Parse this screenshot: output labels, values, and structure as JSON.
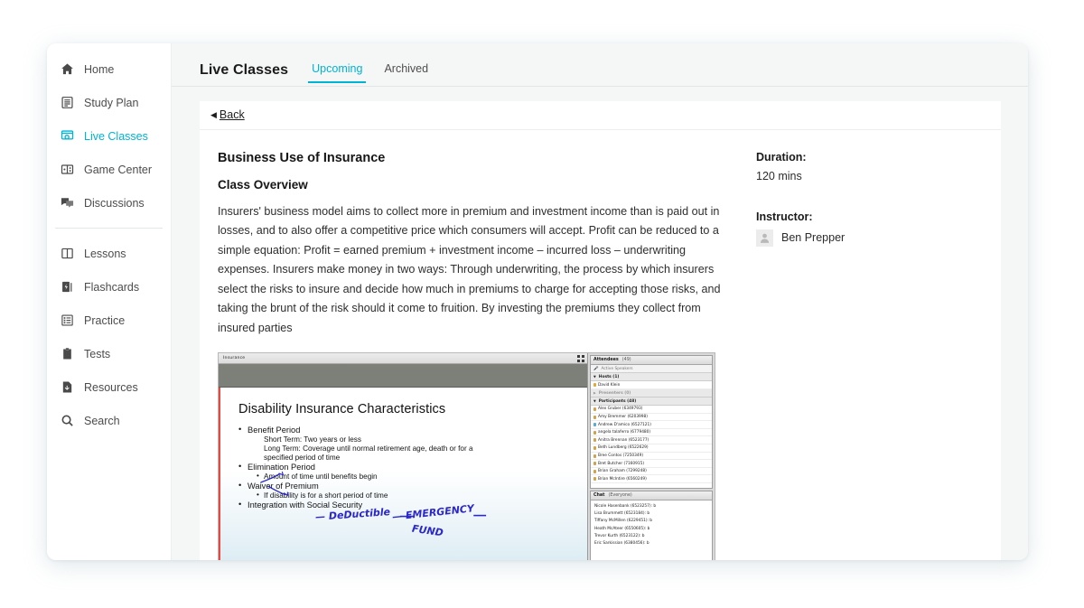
{
  "sidebar": {
    "groups": [
      {
        "items": [
          {
            "label": "Home",
            "icon": "home-icon",
            "active": false
          },
          {
            "label": "Study Plan",
            "icon": "study-plan-icon",
            "active": false
          },
          {
            "label": "Live Classes",
            "icon": "live-classes-icon",
            "active": true
          },
          {
            "label": "Game Center",
            "icon": "game-center-icon",
            "active": false
          },
          {
            "label": "Discussions",
            "icon": "discussions-icon",
            "active": false
          }
        ]
      },
      {
        "items": [
          {
            "label": "Lessons",
            "icon": "lessons-icon",
            "active": false
          },
          {
            "label": "Flashcards",
            "icon": "flashcards-icon",
            "active": false
          },
          {
            "label": "Practice",
            "icon": "practice-icon",
            "active": false
          },
          {
            "label": "Tests",
            "icon": "tests-icon",
            "active": false
          },
          {
            "label": "Resources",
            "icon": "resources-icon",
            "active": false
          },
          {
            "label": "Search",
            "icon": "search-icon",
            "active": false
          }
        ]
      }
    ]
  },
  "header": {
    "title": "Live Classes",
    "tabs": [
      {
        "label": "Upcoming",
        "active": true
      },
      {
        "label": "Archived",
        "active": false
      }
    ]
  },
  "backbar": {
    "caret": "◀",
    "label": "Back"
  },
  "detail": {
    "class_title": "Business Use of Insurance",
    "section_title": "Class Overview",
    "overview": "Insurers' business model aims to collect more in premium and investment income than is paid out in losses, and to also offer a competitive price which consumers will accept. Profit can be reduced to a simple equation: Profit = earned premium + investment income – incurred loss – underwriting expenses. Insurers make money in two ways: Through underwriting, the process by which insurers select the risks to insure and decide how much in premiums to charge for accepting those risks, and taking the brunt of the risk should it come to fruition. By investing the premiums they collect from insured parties",
    "duration_label": "Duration:",
    "duration_value": "120 mins",
    "instructor_label": "Instructor:",
    "instructor_name": "Ben Prepper",
    "instructor_avatar_icon": "person-avatar-icon"
  },
  "video": {
    "window_title": "Insurance",
    "fullscreen_icon": "fullscreen-icon",
    "slide": {
      "heading": "Disability Insurance Characteristics",
      "bullets": [
        {
          "level": 1,
          "text": "Benefit Period",
          "dot": true
        },
        {
          "level": 2,
          "text": "Short Term:  Two years or less",
          "dot": false
        },
        {
          "level": 2,
          "text": "Long Term:  Coverage until normal retirement age, death or for a",
          "dot": false,
          "underline_part": "retirement age,"
        },
        {
          "level": 2,
          "text": "specified period of time",
          "dot": false,
          "continuation": true
        },
        {
          "level": 1,
          "text": "Elimination Period",
          "dot": true
        },
        {
          "level": 2,
          "text": "Amount of time until benefits begin",
          "dot": true
        },
        {
          "level": 1,
          "text": "Waiver of Premium",
          "dot": true
        },
        {
          "level": 2,
          "text": "If disability is for a short period of time",
          "dot": true
        },
        {
          "level": 1,
          "text": "Integration with Social Security",
          "dot": true
        }
      ],
      "annotations": [
        {
          "text": "— DeDuctible",
          "color": "#2a28c8"
        },
        {
          "text": "— EMERGENCY",
          "color": "#2a28c8"
        },
        {
          "text": "FUND",
          "color": "#2a28c8"
        }
      ]
    },
    "attendees": {
      "header": "Attendees",
      "header_count": "(49)",
      "active_speaker": "Active Speakers",
      "groups": [
        {
          "label": "Hosts (1)",
          "dim": false
        },
        {
          "label": "Presenters (0)",
          "dim": true
        },
        {
          "label": "Participants (48)",
          "dim": false
        }
      ],
      "hosts": [
        {
          "name": "David Klein",
          "type": "host"
        }
      ],
      "participants": [
        {
          "name": "Alex Gruber (6349793)",
          "type": "normal"
        },
        {
          "name": "Amy Bremmer (6203998)",
          "type": "normal"
        },
        {
          "name": "Andrew D'amico (6527121)",
          "type": "blue"
        },
        {
          "name": "angela talaferro (6779480)",
          "type": "normal"
        },
        {
          "name": "Anitra Brennan (6523177)",
          "type": "normal"
        },
        {
          "name": "Beth Lundberg (6522629)",
          "type": "normal"
        },
        {
          "name": "Bree Contos (7250349)",
          "type": "normal"
        },
        {
          "name": "Bret Butcher (7160915)",
          "type": "normal"
        },
        {
          "name": "Brian Graham (7299248)",
          "type": "normal"
        },
        {
          "name": "Brian McIntire (6560249)",
          "type": "normal"
        }
      ]
    },
    "chat": {
      "header": "Chat",
      "scope": "(Everyone)",
      "messages": [
        "Nicole Hasenbank (6523257): b",
        "Lisa Brummett (6523184): b",
        "Tiffany McMillen (6229451): b",
        "Heath McAteer (6550605): b",
        "Trevor Kurth (6523122): b",
        "Eric Sarkissian (6380456): b"
      ]
    }
  },
  "colors": {
    "accent": "#00b2d4",
    "page_bg": "#ffffff",
    "card_bg": "#f5f6f6",
    "panel_bg": "#ffffff",
    "slide_accent_bar": "#e8483f",
    "ink": "#2a28c8"
  }
}
